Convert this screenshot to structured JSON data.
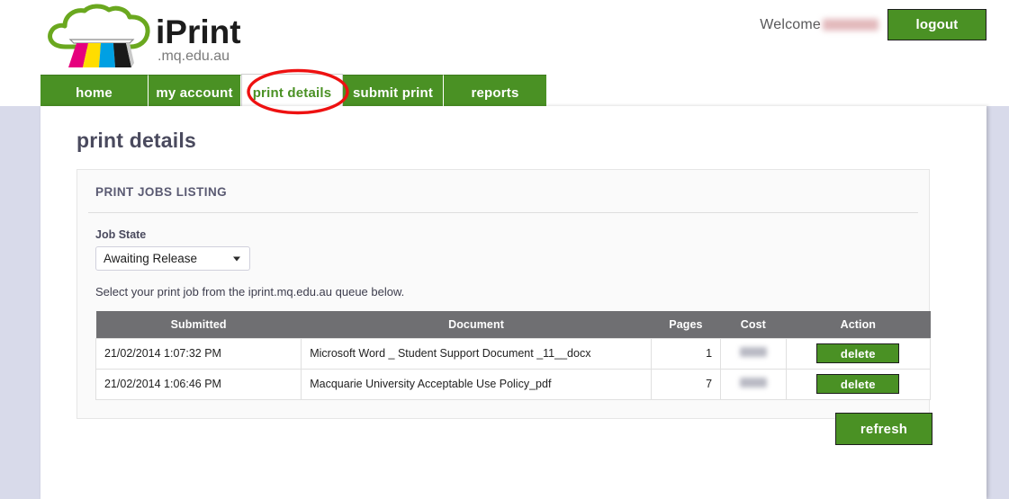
{
  "brand": {
    "name": "iPrint",
    "domain": ".mq.edu.au",
    "colors": {
      "cloud_green": "#6aa81f",
      "stripe_magenta": "#e6007e",
      "stripe_yellow": "#ffdd00",
      "stripe_cyan": "#00a0e3",
      "stripe_black": "#1a1a1a"
    }
  },
  "header": {
    "welcome_text": "Welcome",
    "username_redacted": true,
    "logout_label": "logout"
  },
  "nav": {
    "tabs": [
      {
        "label": "home",
        "active": false
      },
      {
        "label": "my account",
        "active": false
      },
      {
        "label": "print details",
        "active": true
      },
      {
        "label": "submit print",
        "active": false
      },
      {
        "label": "reports",
        "active": false
      }
    ],
    "annotation_color": "#ee1111",
    "annotated_tab": "print details"
  },
  "main": {
    "page_title": "print details",
    "panel_header": "PRINT JOBS LISTING",
    "job_state": {
      "label": "Job State",
      "selected": "Awaiting Release"
    },
    "helper_text": "Select your print job from the iprint.mq.edu.au queue below.",
    "table": {
      "columns": [
        "Submitted",
        "Document",
        "Pages",
        "Cost",
        "Action"
      ],
      "rows": [
        {
          "submitted": "21/02/2014 1:07:32 PM",
          "document": "Microsoft Word _ Student Support Document _11__docx",
          "pages": "1",
          "cost_redacted": true,
          "action_label": "delete"
        },
        {
          "submitted": "21/02/2014 1:06:46 PM",
          "document": "Macquarie University Acceptable Use Policy_pdf",
          "pages": "7",
          "cost_redacted": true,
          "action_label": "delete"
        }
      ]
    },
    "refresh_label": "refresh"
  },
  "theme": {
    "green": "#4a9124",
    "page_background": "#d8daea",
    "table_header_gray": "#6f6f72"
  }
}
